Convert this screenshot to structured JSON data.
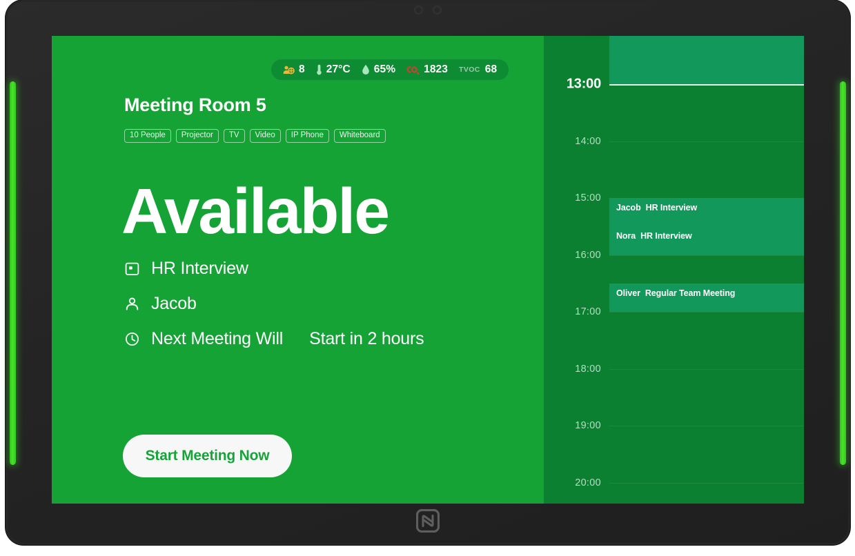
{
  "device": {
    "nfc_icon": "nfc-logo",
    "led_color": "#3fd923",
    "sensor_icons": [
      "camera-sensor",
      "light-sensor"
    ]
  },
  "screen": {
    "background_color": "#15a336",
    "schedule_background_color": "#0b8031",
    "event_color": "#12985a"
  },
  "status_bar": {
    "items": [
      {
        "id": "occupancy",
        "icon": "people-occupancy-icon",
        "icon_color": "#e8b93a",
        "label": "",
        "value": "8"
      },
      {
        "id": "temperature",
        "icon": "thermometer-icon",
        "icon_color": "#a9e6bb",
        "label": "",
        "value": "27°C"
      },
      {
        "id": "humidity",
        "icon": "water-drop-icon",
        "icon_color": "#a9e6bb",
        "label": "",
        "value": "65%"
      },
      {
        "id": "co2",
        "icon": "co2-icon",
        "icon_color": "#e0392e",
        "label": "",
        "value": "1823"
      },
      {
        "id": "tvoc",
        "icon": "",
        "icon_color": "#9ec6a8",
        "label": "TVOC",
        "value": "68"
      }
    ]
  },
  "room": {
    "name": "Meeting Room 5",
    "tags": [
      "10 People",
      "Projector",
      "TV",
      "Video",
      "IP Phone",
      "Whiteboard"
    ],
    "status": "Available",
    "details": [
      {
        "icon": "calendar-event-icon",
        "text": "HR Interview"
      },
      {
        "icon": "person-icon",
        "text": "Jacob"
      },
      {
        "icon": "clock-icon",
        "text_prefix": "Next Meeting Will",
        "text_suffix": "Start in 2 hours"
      }
    ],
    "start_button_label": "Start Meeting Now"
  },
  "schedule": {
    "current_time": "13:00",
    "hours": [
      "13:00",
      "14:00",
      "15:00",
      "16:00",
      "17:00",
      "18:00",
      "19:00",
      "20:00"
    ],
    "events": [
      {
        "organizer": "",
        "title": "",
        "start": "12:00",
        "end": "13:00"
      },
      {
        "organizer": "Jacob",
        "title": "HR Interview",
        "start": "15:00",
        "end": "15:30"
      },
      {
        "organizer": "Nora",
        "title": "HR Interview",
        "start": "15:30",
        "end": "16:00"
      },
      {
        "organizer": "Oliver",
        "title": "Regular Team Meeting",
        "start": "16:30",
        "end": "17:00"
      }
    ]
  }
}
